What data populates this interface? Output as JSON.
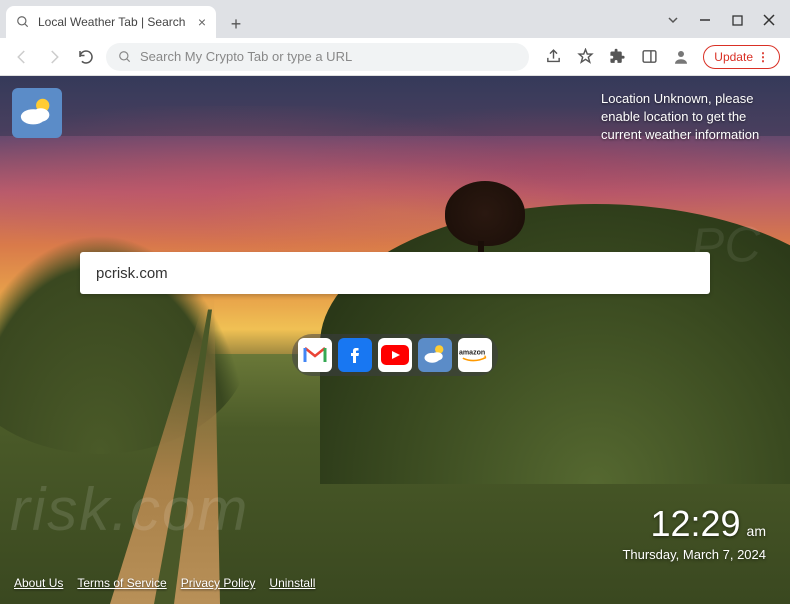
{
  "browser": {
    "tab_title": "Local Weather Tab | Search",
    "omnibox_placeholder": "Search My Crypto Tab or type a URL",
    "update_label": "Update"
  },
  "page": {
    "location_message": "Location Unknown, please enable location to get the current weather information",
    "search_value": "pcrisk.com",
    "quick_links": [
      {
        "name": "gmail",
        "label": "Gmail"
      },
      {
        "name": "facebook",
        "label": "Facebook"
      },
      {
        "name": "youtube",
        "label": "YouTube"
      },
      {
        "name": "weather",
        "label": "Weather"
      },
      {
        "name": "amazon",
        "label": "amazon"
      }
    ],
    "clock": {
      "time": "12:29",
      "ampm": "am",
      "date": "Thursday, March 7, 2024"
    },
    "footer": {
      "about": "About Us",
      "terms": "Terms of Service",
      "privacy": "Privacy Policy",
      "uninstall": "Uninstall"
    }
  }
}
